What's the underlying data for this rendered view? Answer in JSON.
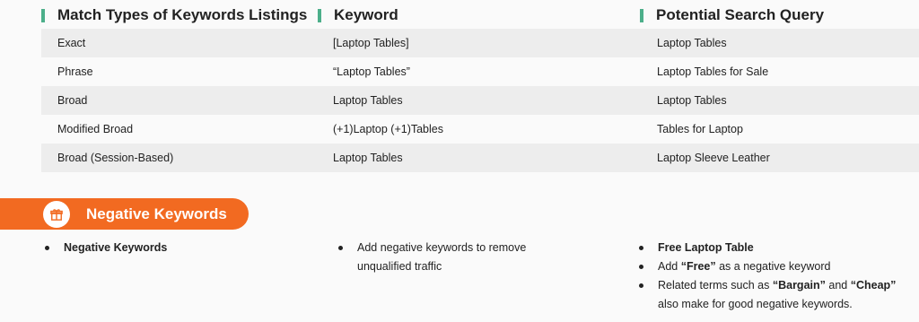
{
  "table": {
    "headers": [
      "Match Types of Keywords Listings",
      "Keyword",
      "Potential Search Query"
    ],
    "rows": [
      [
        "Exact",
        "[Laptop Tables]",
        "Laptop Tables"
      ],
      [
        "Phrase",
        "“Laptop Tables”",
        "Laptop Tables for Sale"
      ],
      [
        "Broad",
        "Laptop Tables",
        "Laptop Tables"
      ],
      [
        "Modified Broad",
        "(+1)Laptop (+1)Tables",
        "Tables for Laptop"
      ],
      [
        "Broad (Session-Based)",
        "Laptop Tables",
        "Laptop Sleeve Leather"
      ]
    ]
  },
  "section": {
    "title": "Negative Keywords",
    "icon": "gift-icon",
    "accent_color": "#f26a21"
  },
  "bullets": {
    "col1": [
      "Negative Keywords"
    ],
    "col2": [
      "Add negative keywords to remove unqualified traffic"
    ],
    "col3": {
      "item1": "Free Laptop Table",
      "item2_pre": "Add ",
      "item2_bold": "“Free”",
      "item2_post": " as a negative keyword",
      "item3_pre": "Related terms such as ",
      "item3_bold1": "“Bargain”",
      "item3_mid": " and ",
      "item3_bold2": "“Cheap”",
      "item3_post": " also make for good negative keywords."
    }
  }
}
